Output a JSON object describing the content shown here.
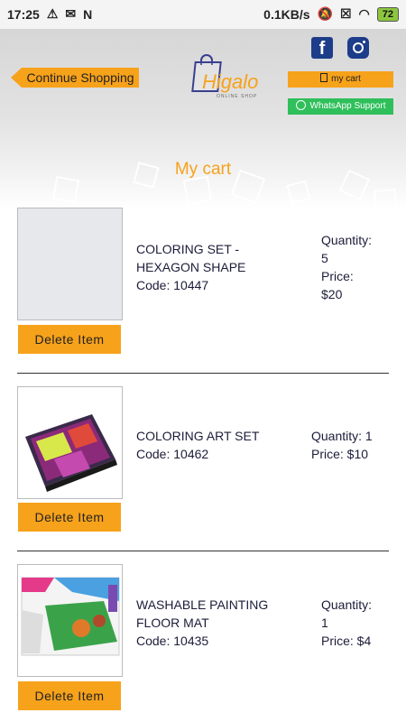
{
  "status_bar": {
    "time": "17:25",
    "speed": "0.1KB/s",
    "battery": "72"
  },
  "header": {
    "continue_label": "Continue Shopping",
    "logo_text": "Higalo",
    "logo_tagline": "ONLINE SHOP",
    "mycart_label": "my cart",
    "whatsapp_label": "WhatsApp Support",
    "facebook_glyph": "f"
  },
  "page_title": "My cart",
  "delete_label": "Delete Item",
  "items": [
    {
      "name_line1": "COLORING SET -",
      "name_line2": "HEXAGON SHAPE",
      "code": "Code: 10447",
      "qty_label": "Quantity:",
      "qty_value": "5",
      "price_label": "Price:",
      "price_value": "$20"
    },
    {
      "name_line1": "COLORING ART SET",
      "code": "Code: 10462",
      "qty": "Quantity: 1",
      "price": "Price: $10"
    },
    {
      "name_line1": "WASHABLE PAINTING",
      "name_line2": "FLOOR MAT",
      "code": "Code: 10435",
      "qty_label": "Quantity:",
      "qty_value": "1",
      "price": "Price: $4"
    }
  ],
  "colors": {
    "accent": "#f7a21b",
    "whatsapp": "#2fbf5b",
    "social": "#1d3c8a",
    "text": "#1c1c3a"
  }
}
